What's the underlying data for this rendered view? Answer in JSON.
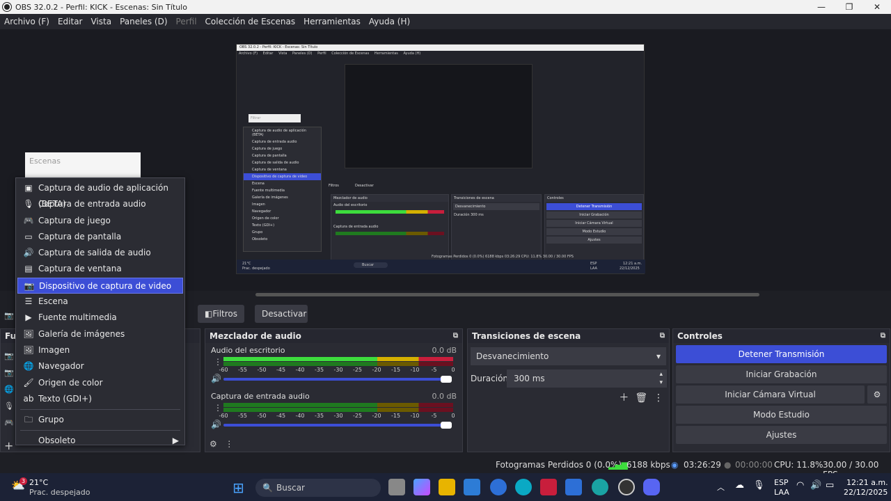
{
  "window": {
    "title": "OBS 32.0.2 - Perfil: KICK - Escenas: Sin Título",
    "min": "—",
    "max": "❐",
    "close": "✕"
  },
  "menu": [
    "Archivo (F)",
    "Editar",
    "Vista",
    "Paneles (D)",
    "Perfil",
    "Colección de Escenas",
    "Herramientas",
    "Ayuda (H)"
  ],
  "scenes_popup": {
    "label": "Escenas"
  },
  "context_menu": {
    "items": [
      {
        "icon": "app-audio-icon",
        "glyph": "▣",
        "label": "Captura de audio de aplicación (BETA)"
      },
      {
        "icon": "mic-icon",
        "glyph": "🎙",
        "label": "Captura de entrada audio"
      },
      {
        "icon": "gamepad-icon",
        "glyph": "🎮",
        "label": "Captura de juego"
      },
      {
        "icon": "monitor-icon",
        "glyph": "▭",
        "label": "Captura de pantalla"
      },
      {
        "icon": "speaker-icon",
        "glyph": "🔊",
        "label": "Captura de salida de audio"
      },
      {
        "icon": "window-icon",
        "glyph": "▤",
        "label": "Captura de ventana"
      },
      {
        "icon": "camera-icon",
        "glyph": "📷",
        "label": "Dispositivo de captura de video"
      },
      {
        "icon": "list-icon",
        "glyph": "☰",
        "label": "Escena"
      },
      {
        "icon": "play-icon",
        "glyph": "▶",
        "label": "Fuente multimedia"
      },
      {
        "icon": "gallery-icon",
        "glyph": "🖼",
        "label": "Galería de imágenes"
      },
      {
        "icon": "image-icon",
        "glyph": "🖼",
        "label": "Imagen"
      },
      {
        "icon": "globe-icon",
        "glyph": "🌐",
        "label": "Navegador"
      },
      {
        "icon": "brush-icon",
        "glyph": "🖌",
        "label": "Origen de color"
      },
      {
        "icon": "text-icon",
        "glyph": "ab",
        "label": "Texto (GDI+)"
      }
    ],
    "group": {
      "icon": "folder-icon",
      "glyph": "🗀",
      "label": "Grupo"
    },
    "obsolete": {
      "label": "Obsoleto",
      "arrow": "▶"
    }
  },
  "source_toolbar": {
    "filters": "Filtros",
    "deactivate": "Desactivar"
  },
  "mixer": {
    "title": "Mezclador de audio",
    "channels": [
      {
        "name": "Audio del escritorio",
        "db": "0.0 dB"
      },
      {
        "name": "Captura de entrada audio",
        "db": "0.0 dB"
      }
    ],
    "ticks": [
      "-60",
      "-55",
      "-50",
      "-45",
      "-40",
      "-35",
      "-30",
      "-25",
      "-20",
      "-15",
      "-10",
      "-5",
      "0"
    ]
  },
  "transitions": {
    "title": "Transiciones de escena",
    "selected": "Desvanecimiento",
    "duration_label": "Duración",
    "duration_value": "300 ms"
  },
  "controls": {
    "title": "Controles",
    "stop_stream": "Detener Transmisión",
    "start_rec": "Iniciar Grabación",
    "virtual_cam": "Iniciar Cámara Virtual",
    "studio": "Modo Estudio",
    "settings": "Ajustes"
  },
  "dock_partial": {
    "sources_label": "Fu"
  },
  "status": {
    "dropped": "Fotogramas Perdidos 0 (0.0%)",
    "kbps": "6188 kbps",
    "stream_time": "03:26:29",
    "rec_time": "00:00:00",
    "cpu": "CPU: 11.8%",
    "fps": "30.00 / 30.00 FPS"
  },
  "taskbar": {
    "weather_temp": "21°C",
    "weather_desc": "Prac. despejado",
    "weather_badge": "3",
    "search": "Buscar",
    "lang1": "ESP",
    "lang2": "LAA",
    "time": "12:21 a.m.",
    "date": "22/12/2025"
  },
  "inner_preview": {
    "title": "OBS 32.0.2 - Perfil: KICK - Escenas: Sin Título",
    "menu": [
      "Archivo (F)",
      "Editar",
      "Vista",
      "Paneles (D)",
      "Perfil",
      "Colección de Escenas",
      "Herramientas",
      "Ayuda (H)"
    ],
    "filter_label": "Filtrar",
    "menu_items": [
      "Captura de audio de aplicación (BETA)",
      "Captura de entrada audio",
      "Captura de juego",
      "Captura de pantalla",
      "Captura de salida de audio",
      "Captura de ventana",
      "Dispositivo de captura de video",
      "Escena",
      "Fuente multimedia",
      "Galería de imágenes",
      "Imagen",
      "Navegador",
      "Origen de color",
      "Texto (GDI+)",
      "Grupo",
      "Obsoleto"
    ],
    "filters": "Filtros",
    "deactivate": "Desactivar",
    "mixer": "Mezclador de audio",
    "mix1": "Audio del escritorio",
    "mix2": "Captura de entrada audio",
    "transitions": "Transiciones de escena",
    "fade": "Desvanecimiento",
    "duration": "Duración",
    "duration_value": "300 ms",
    "controls": "Controles",
    "c1": "Detener Transmisión",
    "c2": "Iniciar Grabación",
    "c3": "Iniciar Cámara Virtual",
    "c4": "Modo Estudio",
    "c5": "Ajustes",
    "status": "Fotogramas Perdidos 0 (0.0%)",
    "kbps": "6188 kbps",
    "time": "03:26:29",
    "cpu": "CPU: 11.8%",
    "fps": "30.00 / 30.00 FPS",
    "search": "Buscar",
    "temp": "21°C",
    "weather": "Prac. despejado",
    "esp": "ESP",
    "laa": "LAA",
    "clock": "12:21 a.m.",
    "date": "22/12/2025"
  },
  "colors": {
    "accent": "#3c4ed6",
    "green": "#3ddc3d",
    "yellow": "#d4b000",
    "red": "#c81e3c"
  }
}
